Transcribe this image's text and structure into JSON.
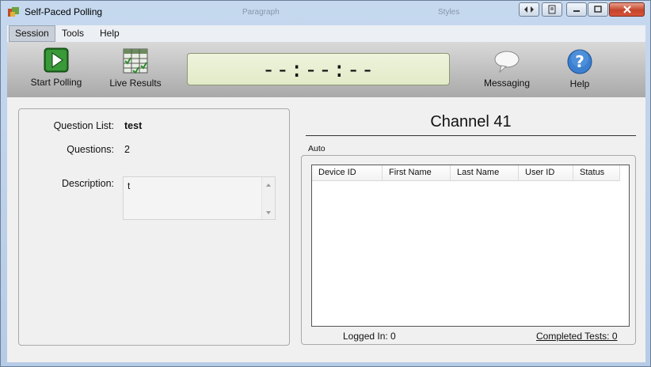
{
  "window": {
    "title": "Self-Paced Polling",
    "ghost_labels": [
      "Paragraph",
      "Styles"
    ]
  },
  "menu": {
    "items": [
      "Session",
      "Tools",
      "Help"
    ]
  },
  "toolbar": {
    "start_polling": "Start Polling",
    "live_results": "Live Results",
    "timer": "--:--:--",
    "messaging": "Messaging",
    "help": "Help"
  },
  "details": {
    "question_list_label": "Question List:",
    "question_list_value": "test",
    "questions_label": "Questions:",
    "questions_value": "2",
    "description_label": "Description:",
    "description_value": "t"
  },
  "channel": {
    "title": "Channel 41",
    "mode": "Auto"
  },
  "devices_table": {
    "columns": [
      "Device ID",
      "First Name",
      "Last Name",
      "User ID",
      "Status"
    ],
    "rows": []
  },
  "footer": {
    "logged_in": "Logged In: 0",
    "completed_tests": "Completed Tests:  0"
  },
  "colors": {
    "accent_green": "#2f8a2f",
    "help_blue": "#3a7fd0",
    "lcd_bg": "#e6eed0",
    "close_red": "#c5452b"
  }
}
